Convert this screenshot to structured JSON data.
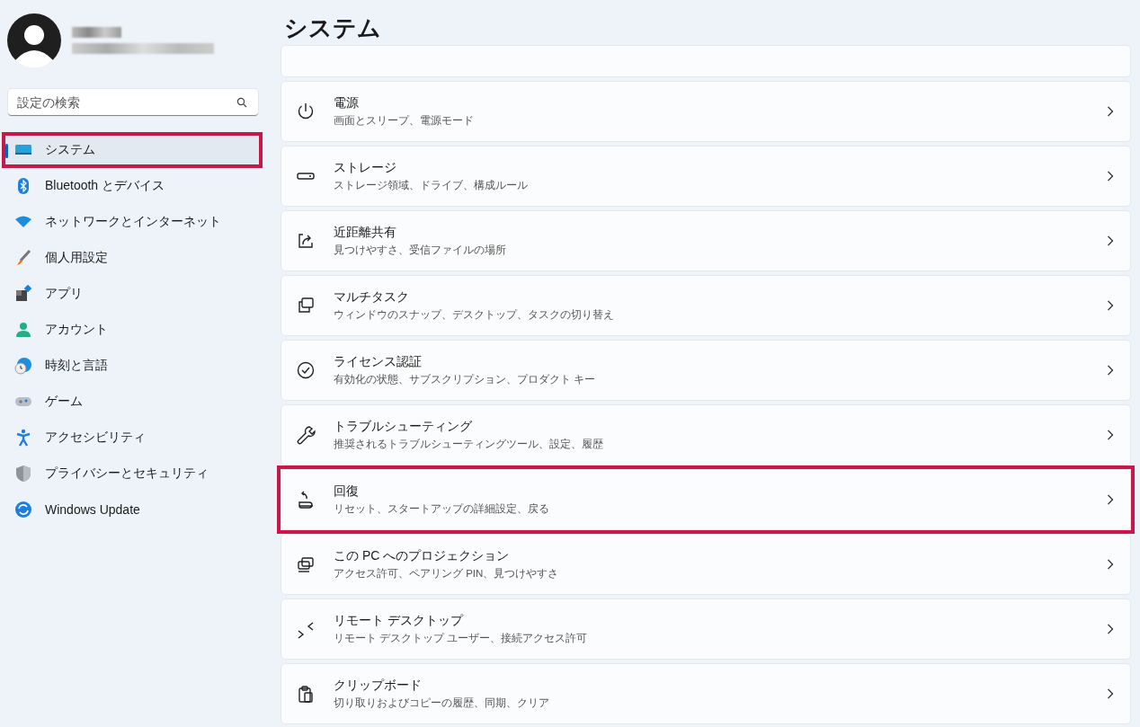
{
  "sidebar": {
    "search": {
      "placeholder": "設定の検索"
    },
    "items": [
      {
        "label": "システム",
        "kind": "system",
        "selected": true,
        "highlighted": true
      },
      {
        "label": "Bluetooth とデバイス",
        "kind": "bluetooth",
        "selected": false,
        "highlighted": false
      },
      {
        "label": "ネットワークとインターネット",
        "kind": "network",
        "selected": false,
        "highlighted": false
      },
      {
        "label": "個人用設定",
        "kind": "brush",
        "selected": false,
        "highlighted": false
      },
      {
        "label": "アプリ",
        "kind": "apps",
        "selected": false,
        "highlighted": false
      },
      {
        "label": "アカウント",
        "kind": "account",
        "selected": false,
        "highlighted": false
      },
      {
        "label": "時刻と言語",
        "kind": "time",
        "selected": false,
        "highlighted": false
      },
      {
        "label": "ゲーム",
        "kind": "game",
        "selected": false,
        "highlighted": false
      },
      {
        "label": "アクセシビリティ",
        "kind": "accessibility",
        "selected": false,
        "highlighted": false
      },
      {
        "label": "プライバシーとセキュリティ",
        "kind": "shield",
        "selected": false,
        "highlighted": false
      },
      {
        "label": "Windows Update",
        "kind": "update",
        "selected": false,
        "highlighted": false
      }
    ]
  },
  "main": {
    "title": "システム",
    "cards": [
      {
        "title": "電源",
        "subtitle": "画面とスリープ、電源モード",
        "kind": "power",
        "highlighted": false
      },
      {
        "title": "ストレージ",
        "subtitle": "ストレージ領域、ドライブ、構成ルール",
        "kind": "storage",
        "highlighted": false
      },
      {
        "title": "近距離共有",
        "subtitle": "見つけやすさ、受信ファイルの場所",
        "kind": "share",
        "highlighted": false
      },
      {
        "title": "マルチタスク",
        "subtitle": "ウィンドウのスナップ、デスクトップ、タスクの切り替え",
        "kind": "multitask",
        "highlighted": false
      },
      {
        "title": "ライセンス認証",
        "subtitle": "有効化の状態、サブスクリプション、プロダクト キー",
        "kind": "check",
        "highlighted": false
      },
      {
        "title": "トラブルシューティング",
        "subtitle": "推奨されるトラブルシューティングツール、設定、履歴",
        "kind": "wrench",
        "highlighted": false
      },
      {
        "title": "回復",
        "subtitle": "リセット、スタートアップの詳細設定、戻る",
        "kind": "recovery",
        "highlighted": true
      },
      {
        "title": "この PC へのプロジェクション",
        "subtitle": "アクセス許可、ペアリング PIN、見つけやすさ",
        "kind": "projection",
        "highlighted": false
      },
      {
        "title": "リモート デスクトップ",
        "subtitle": "リモート デスクトップ ユーザー、接続アクセス許可",
        "kind": "remote",
        "highlighted": false
      },
      {
        "title": "クリップボード",
        "subtitle": "切り取りおよびコピーの履歴、同期、クリア",
        "kind": "clipboard",
        "highlighted": false
      }
    ]
  }
}
